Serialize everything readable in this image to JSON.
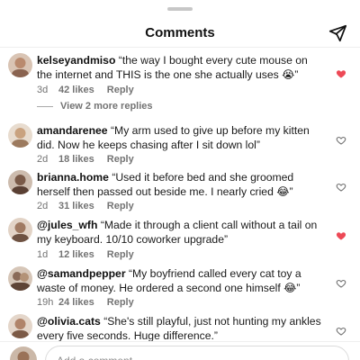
{
  "header": {
    "title": "Comments"
  },
  "comments": [
    {
      "username": "kelseyandmiso",
      "text": "“the way I bought every cute mouse on the internet and THIS is the one she actually uses 😭”",
      "time": "3d",
      "likes": "42 likes",
      "reply": "Reply",
      "liked": true,
      "avatar_color": "#b98a6e"
    },
    {
      "username": "amandarenee",
      "text": "“My arm used to give up before my kitten did. Now he keeps chasing after I sit down lol”",
      "time": "2d",
      "likes": "18 likes",
      "reply": "Reply",
      "liked": false,
      "avatar_color": "#c9a27f"
    },
    {
      "username": "brianna.home",
      "text": "“Used it before bed and she groomed herself then passed out beside me. I nearly cried 😂”",
      "time": "2d",
      "likes": "31 likes",
      "reply": "Reply",
      "liked": false,
      "avatar_color": "#7a5a48"
    },
    {
      "username": "@jules_wfh",
      "text": "“Made it through a client call without a tail on my keyboard. 10/10 coworker upgrade”",
      "time": "1d",
      "likes": "12 likes",
      "reply": "Reply",
      "liked": true,
      "avatar_color": "#a07a62"
    },
    {
      "username": "@samandpepper",
      "text": "“My boyfriend called every cat toy a waste of money. He ordered a second one himself 😂”",
      "time": "19h",
      "likes": "24 likes",
      "reply": "Reply",
      "liked": false,
      "avatar_color": "#8a6a58"
    },
    {
      "username": "@olivia.cats",
      "text": "“She's still playful, just not hunting my ankles every five seconds. Huge difference.”",
      "time": "",
      "likes": "",
      "reply": "",
      "liked": false,
      "avatar_color": "#b0846a"
    }
  ],
  "view_replies": "View 2 more replies",
  "input": {
    "placeholder": "Add a comment..."
  },
  "colors": {
    "heart_liked": "#ed4956",
    "muted_text": "#737373"
  },
  "icons": {
    "share": "paper-plane-icon",
    "like": "heart-icon"
  }
}
